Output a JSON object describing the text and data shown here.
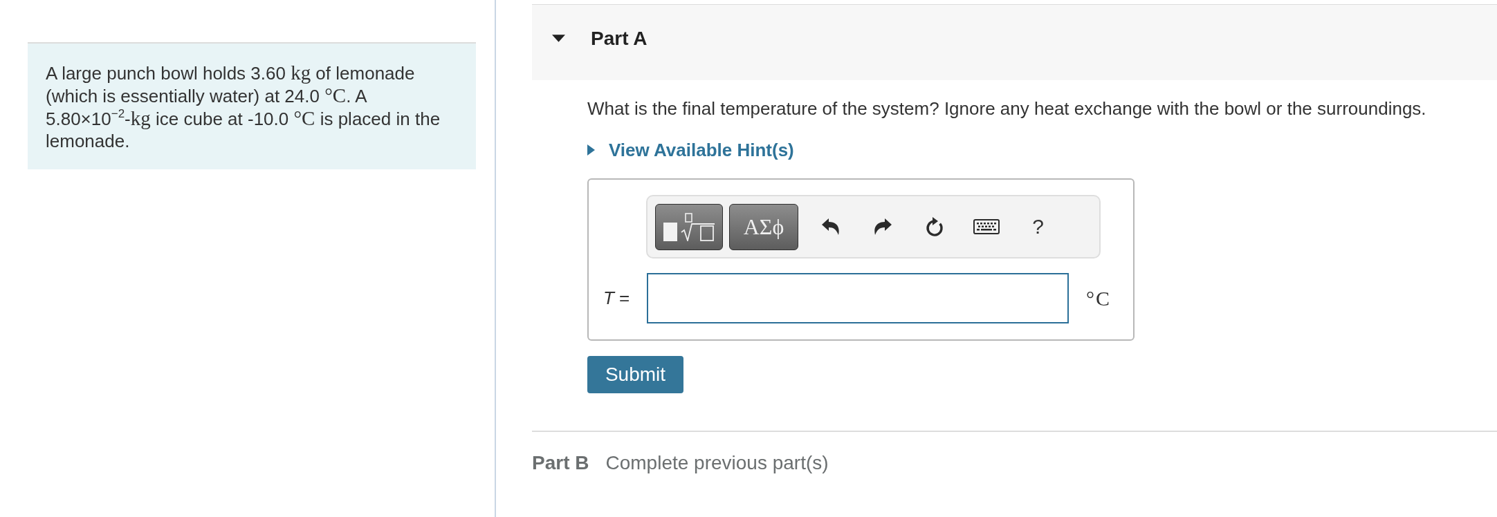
{
  "problem": {
    "segments": [
      {
        "kind": "text",
        "text": "A large punch bowl holds 3.60 "
      },
      {
        "kind": "math",
        "text": "kg"
      },
      {
        "kind": "text",
        "text": " of lemonade (which is essentially water) at 24.0 "
      },
      {
        "kind": "math",
        "text": "°C"
      },
      {
        "kind": "text",
        "text": ". A 5.80×10$^{−2}$-"
      },
      {
        "kind": "math",
        "text": "kg"
      },
      {
        "kind": "text",
        "text": " ice cube at -10.0 "
      },
      {
        "kind": "math",
        "text": "°C"
      },
      {
        "kind": "text",
        "text": " is placed in the lemonade."
      }
    ]
  },
  "part_a": {
    "title": "Part A",
    "expanded": true,
    "question": "What is the final temperature of the system? Ignore any heat exchange with the bowl or the surroundings.",
    "hint": {
      "label": "View Available Hint(s)",
      "expanded": false
    },
    "answer": {
      "toolbar": [
        {
          "kind": "templates"
        },
        {
          "kind": "symbols",
          "label": "ΑΣϕ"
        },
        {
          "kind": "undo"
        },
        {
          "kind": "redo"
        },
        {
          "kind": "reset"
        },
        {
          "kind": "keyboard"
        },
        {
          "kind": "help",
          "label": "?"
        }
      ],
      "label": "*T* =",
      "unit": "°C"
    },
    "submit": "Submit"
  },
  "part_b": {
    "title": "Part B",
    "status": "Complete previous part(s)"
  }
}
